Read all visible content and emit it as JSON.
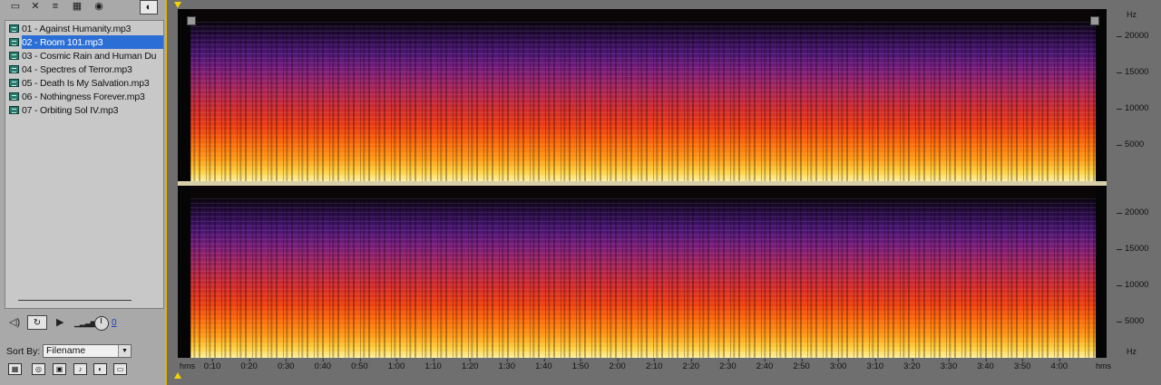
{
  "files_panel": {
    "toolbar_icons": [
      "open-folder-icon",
      "close-file-icon",
      "insert-into-multitrack-icon",
      "edit-file-icon",
      "autoplay-icon",
      "show-filetype-icon"
    ],
    "files": [
      {
        "label": "01 - Against Humanity.mp3",
        "selected": false
      },
      {
        "label": "02 - Room 101.mp3",
        "selected": true
      },
      {
        "label": "03 - Cosmic Rain and Human Du",
        "selected": false
      },
      {
        "label": "04 - Spectres of Terror.mp3",
        "selected": false
      },
      {
        "label": "05 - Death Is My Salvation.mp3",
        "selected": false
      },
      {
        "label": "06 - Nothingness Forever.mp3",
        "selected": false
      },
      {
        "label": "07 - Orbiting Sol IV.mp3",
        "selected": false
      }
    ],
    "transport": {
      "play_glyph": "▶",
      "volume_value": "0"
    },
    "sort": {
      "label": "Sort By:",
      "selected": "Filename"
    }
  },
  "spectral_view": {
    "hz_unit": "Hz",
    "hz_ticks_top": [
      "20000",
      "15000",
      "10000",
      "5000"
    ],
    "hz_ticks_bottom": [
      "20000",
      "15000",
      "10000",
      "5000"
    ],
    "hz_axis_max": 22000,
    "time_unit": "hms",
    "time_ticks": [
      "0:10",
      "0:20",
      "0:30",
      "0:40",
      "0:50",
      "1:00",
      "1:10",
      "1:20",
      "1:30",
      "1:40",
      "1:50",
      "2:00",
      "2:10",
      "2:20",
      "2:30",
      "2:40",
      "2:50",
      "3:00",
      "3:10",
      "3:20",
      "3:30",
      "3:40",
      "3:50",
      "4:00"
    ],
    "colors": {
      "accent_yellow": "#f2d200",
      "selection_blue": "#2b6fd6"
    }
  }
}
